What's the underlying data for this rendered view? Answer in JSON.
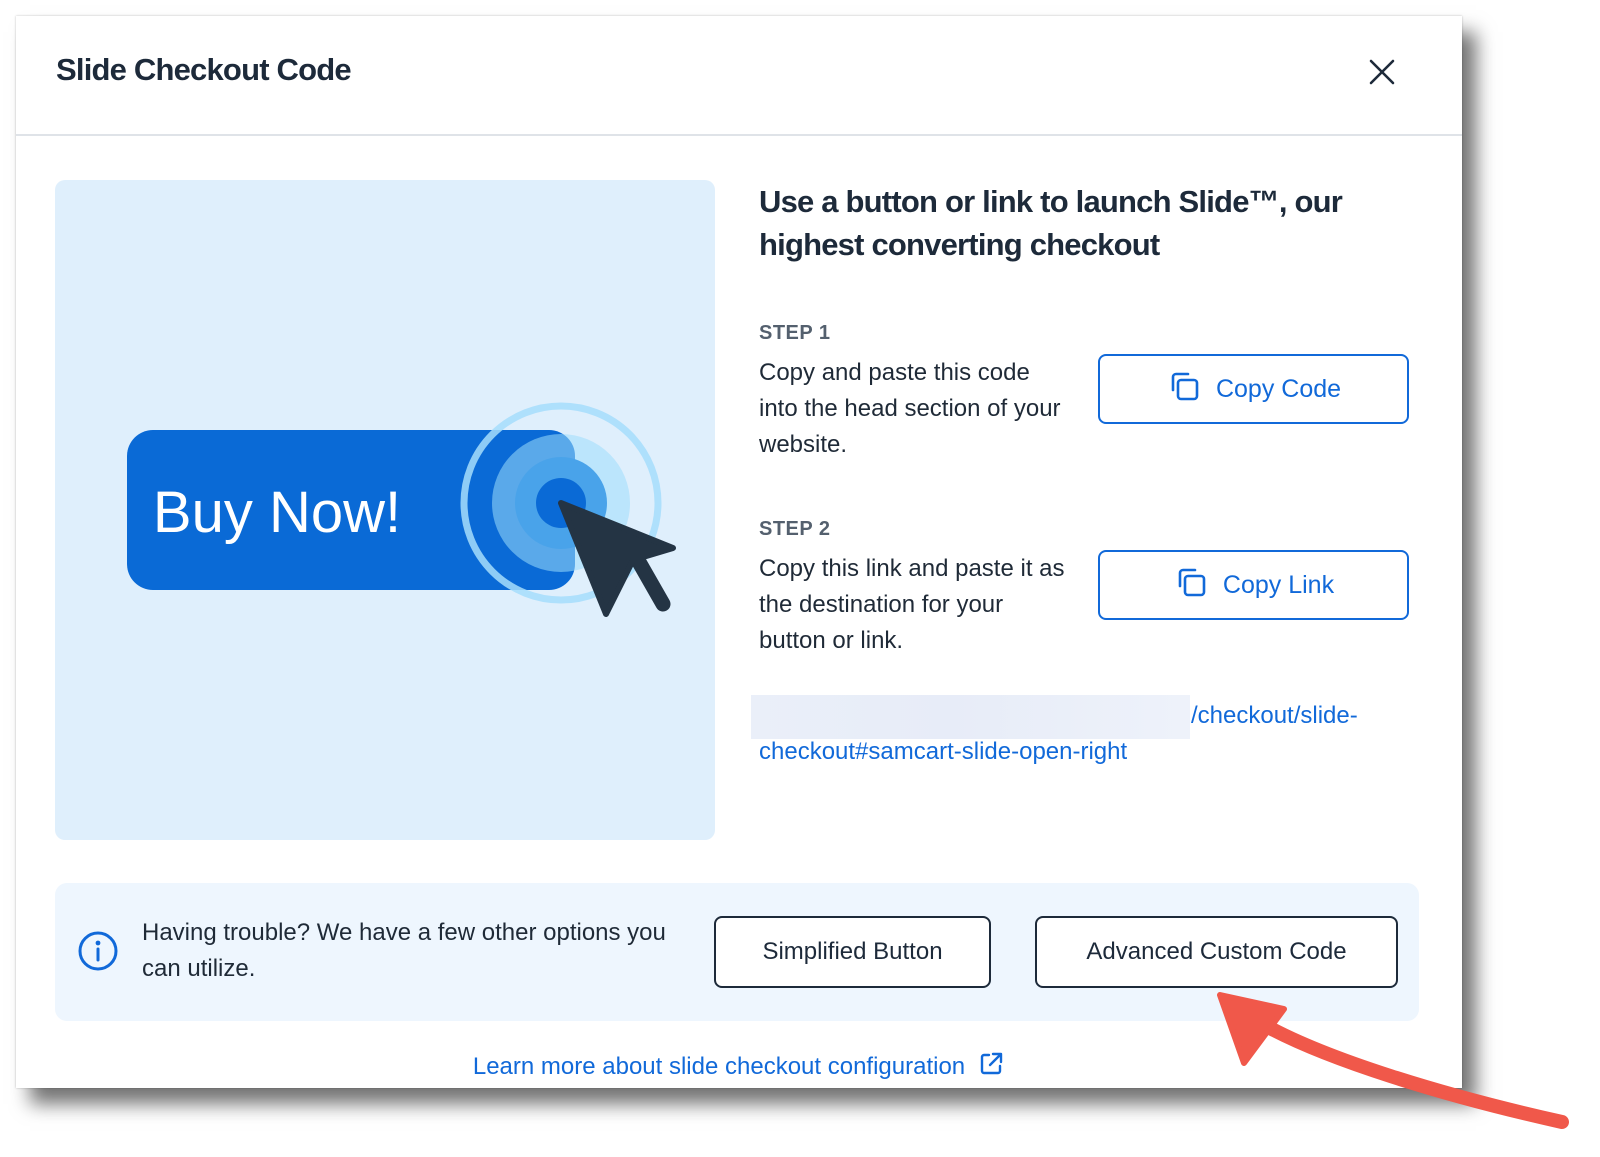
{
  "modal": {
    "title": "Slide Checkout Code",
    "close_icon": "close-icon"
  },
  "illustration": {
    "button_label": "Buy Now!",
    "icon": "cursor-click-icon"
  },
  "headline": "Use a button or link to launch Slide™, our highest converting checkout",
  "step1": {
    "label": "STEP 1",
    "text": "Copy and paste this code into the head section of your website.",
    "button_label": "Copy Code",
    "button_icon": "copy-icon"
  },
  "step2": {
    "label": "STEP 2",
    "text": "Copy this link and paste it as the destination for your button or link.",
    "button_label": "Copy Link",
    "button_icon": "copy-icon"
  },
  "checkout_link": {
    "visible_text": "/checkout/slide-checkout#samcart-slide-open-right"
  },
  "help": {
    "icon": "info-icon",
    "text": "Having trouble? We have a few other options you can utilize.",
    "simplified_button_label": "Simplified Button",
    "advanced_button_label": "Advanced Custom Code"
  },
  "learn_more": {
    "label": "Learn more about slide checkout configuration",
    "icon": "external-link-icon"
  },
  "colors": {
    "accent": "#1169d9",
    "illustration_bg": "#dfeffc",
    "help_bg": "#eef6fe",
    "annotation_arrow": "#f0584a",
    "text_dark": "#1d2a3a"
  }
}
